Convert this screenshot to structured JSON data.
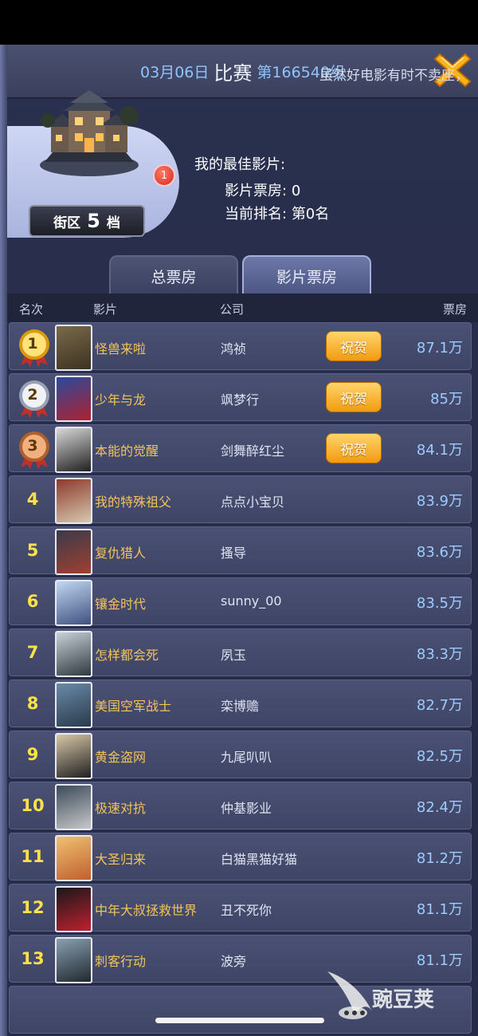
{
  "header": {
    "date": "03月06日",
    "match_label": "比赛",
    "group_label": "第166540组"
  },
  "marquee": "虽然好电影有时不卖座，",
  "district": {
    "label_prefix": "街区",
    "level": "5",
    "label_suffix": "档",
    "notification_count": "1"
  },
  "best_movie": {
    "title": "我的最佳影片:",
    "boxoffice_label": "影片票房:",
    "boxoffice_value": "0",
    "rank_label": "当前排名:",
    "rank_value": "第0名"
  },
  "tabs": [
    {
      "label": "总票房",
      "active": false
    },
    {
      "label": "影片票房",
      "active": true
    }
  ],
  "table": {
    "headers": {
      "rank": "名次",
      "movie": "影片",
      "company": "公司",
      "boxoffice": "票房"
    },
    "congrats_label": "祝贺",
    "rows": [
      {
        "rank": "1",
        "movie": "怪兽来啦",
        "company": "鸿祯",
        "boxoffice": "87.1万",
        "medal": "gold"
      },
      {
        "rank": "2",
        "movie": "少年与龙",
        "company": "飒梦行",
        "boxoffice": "85万",
        "medal": "silver"
      },
      {
        "rank": "3",
        "movie": "本能的觉醒",
        "company": "剑舞醉红尘",
        "boxoffice": "84.1万",
        "medal": "bronze"
      },
      {
        "rank": "4",
        "movie": "我的特殊祖父",
        "company": "点点小宝贝",
        "boxoffice": "83.9万"
      },
      {
        "rank": "5",
        "movie": "复仇猎人",
        "company": "搔导",
        "boxoffice": "83.6万"
      },
      {
        "rank": "6",
        "movie": "镶金时代",
        "company": "sunny_00",
        "boxoffice": "83.5万"
      },
      {
        "rank": "7",
        "movie": "怎样都会死",
        "company": "夙玉",
        "boxoffice": "83.3万"
      },
      {
        "rank": "8",
        "movie": "美国空军战士",
        "company": "栾博赡",
        "boxoffice": "82.7万"
      },
      {
        "rank": "9",
        "movie": "黄金盗网",
        "company": "九尾叭叭",
        "boxoffice": "82.5万"
      },
      {
        "rank": "10",
        "movie": "极速对抗",
        "company": "仲基影业",
        "boxoffice": "82.4万"
      },
      {
        "rank": "11",
        "movie": "大圣归来",
        "company": "白猫黑猫好猫",
        "boxoffice": "81.2万"
      },
      {
        "rank": "12",
        "movie": "中年大叔拯救世界",
        "company": "丑不死你",
        "boxoffice": "81.1万"
      },
      {
        "rank": "13",
        "movie": "刺客行动",
        "company": "波旁",
        "boxoffice": "81.1万"
      }
    ]
  },
  "watermark": "豌豆荚",
  "colors": {
    "accent_gold": "#f4c35a",
    "boxoffice_blue": "#9ecbff",
    "congrats_orange": "#f19b10"
  }
}
